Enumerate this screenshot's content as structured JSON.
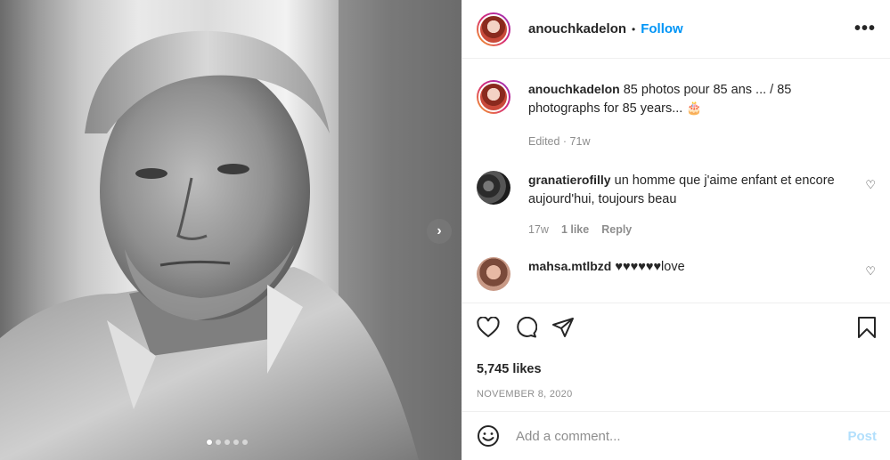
{
  "post": {
    "author": "anouchkadelon",
    "follow_label": "Follow",
    "header_separator": "•",
    "more_icon": "more-horizontal-icon",
    "next_icon": "chevron-right-icon",
    "image_dots": 5,
    "active_dot": 1
  },
  "caption": {
    "username": "anouchkadelon",
    "text": "85 photos pour 85 ans ... / 85 photographs for 85 years... 🎂",
    "meta": "Edited · 71w"
  },
  "comments": [
    {
      "username": "granatierofilly",
      "text": "un homme que j'aime enfant et encore aujourd'hui, toujours beau",
      "time": "17w",
      "likes": "1 like",
      "reply": "Reply"
    },
    {
      "username": "mahsa.mtlbzd",
      "text": "♥♥♥♥♥♥love"
    }
  ],
  "actions": {
    "likes": "5,745 likes",
    "date": "NOVEMBER 8, 2020"
  },
  "add_comment": {
    "placeholder": "Add a comment...",
    "post_label": "Post"
  },
  "colors": {
    "accent": "#0095f6",
    "post_disabled": "#b2dffc",
    "muted": "#8e8e8e",
    "text": "#262626"
  }
}
